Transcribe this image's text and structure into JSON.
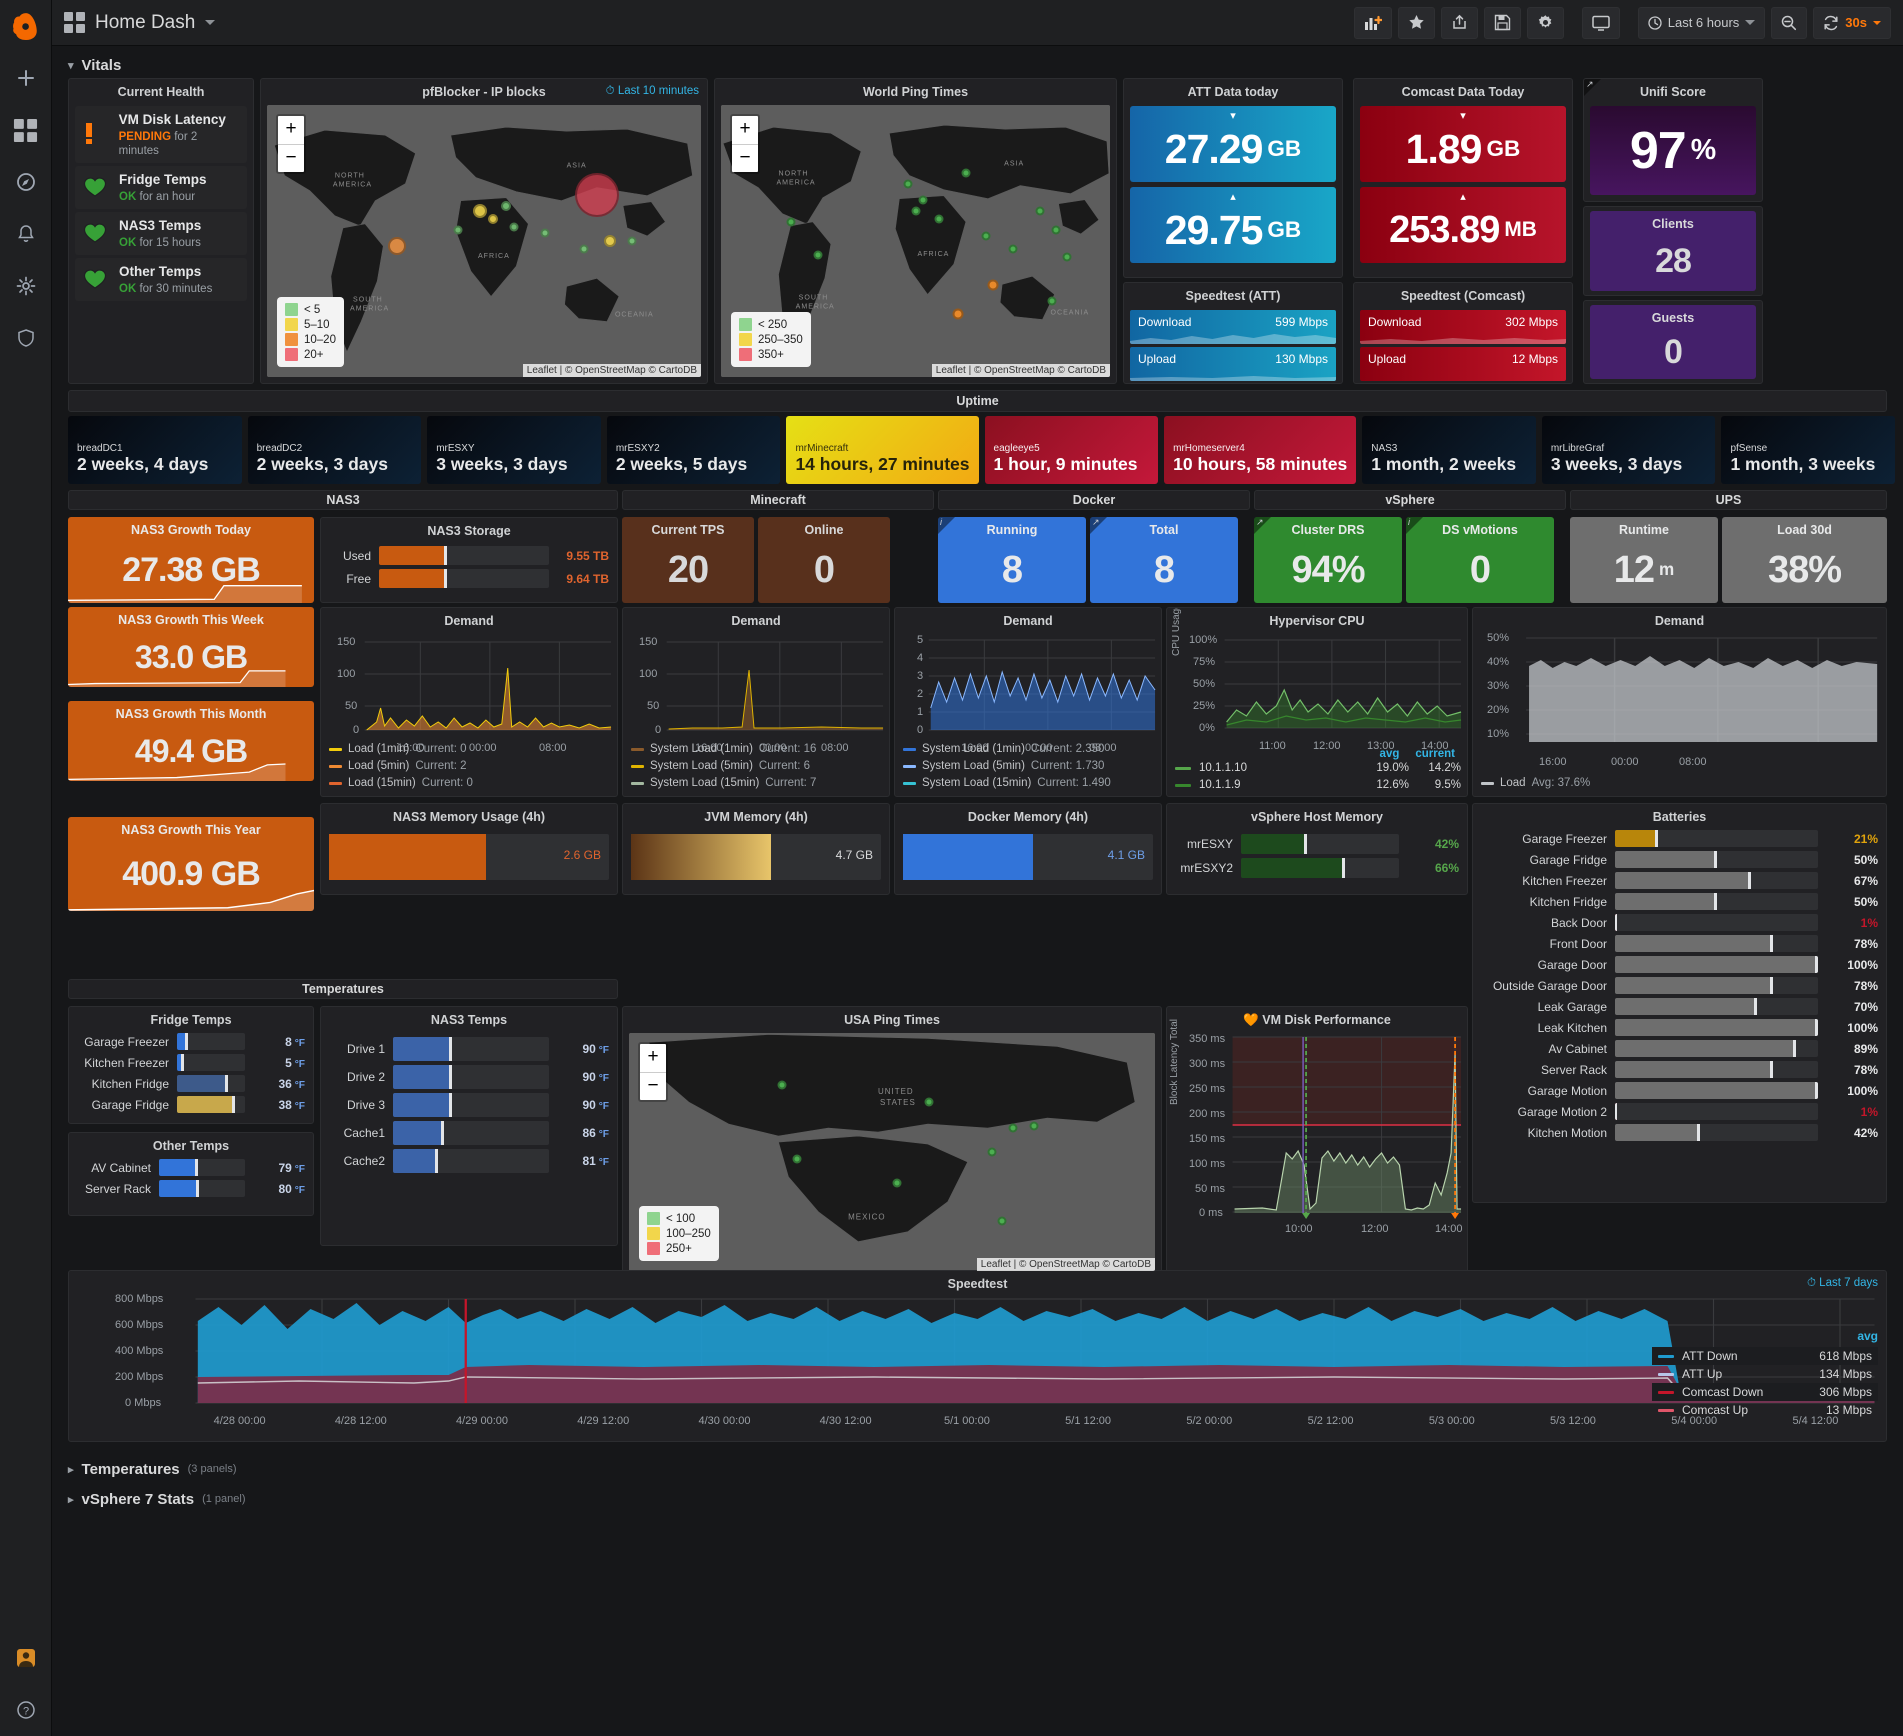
{
  "app": {
    "title": "Home Dash",
    "logo_icon": "grafana-logo"
  },
  "toolbar": {
    "add_panel_icon": "add-panel-icon",
    "star_icon": "star-icon",
    "share_icon": "share-icon",
    "save_icon": "save-icon",
    "settings_icon": "gear-icon",
    "tv_icon": "tv-mode-icon",
    "time_picker": "Last 6 hours",
    "zoom_out_icon": "zoom-out-icon",
    "refresh_icon": "refresh-icon",
    "refresh_interval": "30s"
  },
  "sidenav": [
    {
      "name": "create",
      "icon": "plus-icon"
    },
    {
      "name": "dashboards",
      "icon": "dashboards-icon"
    },
    {
      "name": "explore",
      "icon": "compass-icon"
    },
    {
      "name": "alerting",
      "icon": "bell-icon"
    },
    {
      "name": "configuration",
      "icon": "gear-icon"
    },
    {
      "name": "shield",
      "icon": "shield-icon"
    },
    {
      "name": "user",
      "icon": "avatar-icon"
    },
    {
      "name": "help",
      "icon": "question-icon"
    }
  ],
  "rows": {
    "vitals": "Vitals",
    "uptime": "Uptime",
    "temperatures": "Temperatures",
    "temperatures_count": "(3 panels)",
    "vsphere7": "vSphere 7 Stats",
    "vsphere7_count": "(1 panel)"
  },
  "current_health": {
    "title": "Current Health",
    "items": [
      {
        "name": "VM Disk Latency",
        "state": "PENDING",
        "detail": "for 2 minutes",
        "icon": "exclamation-icon",
        "color": "#ff780a"
      },
      {
        "name": "Fridge Temps",
        "state": "OK",
        "detail": "for an hour",
        "icon": "heart-icon",
        "color": "#37a137"
      },
      {
        "name": "NAS3 Temps",
        "state": "OK",
        "detail": "for 15 hours",
        "icon": "heart-icon",
        "color": "#37a137"
      },
      {
        "name": "Other Temps",
        "state": "OK",
        "detail": "for 30 minutes",
        "icon": "heart-icon",
        "color": "#37a137"
      }
    ]
  },
  "pfblocker": {
    "title": "pfBlocker - IP blocks",
    "time_range": "Last 10 minutes",
    "zoom_in": "+",
    "zoom_out": "−",
    "legend": [
      {
        "label": "< 5",
        "color": "#8fd48f"
      },
      {
        "label": "5–10",
        "color": "#f2d64b"
      },
      {
        "label": "10–20",
        "color": "#f0913e"
      },
      {
        "label": "20+",
        "color": "#ef6e78"
      }
    ],
    "attribution": "Leaflet | © OpenStreetMap © CartoDB"
  },
  "world_ping": {
    "title": "World Ping Times",
    "legend": [
      {
        "label": "< 250",
        "color": "#8fd48f"
      },
      {
        "label": "250–350",
        "color": "#f2d64b"
      },
      {
        "label": "350+",
        "color": "#ef6e78"
      }
    ],
    "attribution": "Leaflet | © OpenStreetMap © CartoDB"
  },
  "usa_ping": {
    "title": "USA Ping Times",
    "legend": [
      {
        "label": "< 100",
        "color": "#8fd48f"
      },
      {
        "label": "100–250",
        "color": "#f2d64b"
      },
      {
        "label": "250+",
        "color": "#ef6e78"
      }
    ],
    "attribution": "Leaflet | © OpenStreetMap © CartoDB"
  },
  "att": {
    "title": "ATT Data today",
    "down": {
      "value": "27.29",
      "unit": "GB",
      "arrow": "down"
    },
    "up": {
      "value": "29.75",
      "unit": "GB",
      "arrow": "up"
    },
    "speedtest_title": "Speedtest (ATT)",
    "download_label": "Download",
    "download_value": "599 Mbps",
    "upload_label": "Upload",
    "upload_value": "130 Mbps",
    "color": "#1a8cbe"
  },
  "comcast": {
    "title": "Comcast Data Today",
    "down": {
      "value": "1.89",
      "unit": "GB",
      "arrow": "down"
    },
    "up": {
      "value": "253.89",
      "unit": "MB",
      "arrow": "up"
    },
    "speedtest_title": "Speedtest (Comcast)",
    "download_label": "Download",
    "download_value": "302 Mbps",
    "upload_label": "Upload",
    "upload_value": "12 Mbps",
    "color": "#a00a1e"
  },
  "unifi": {
    "title": "Unifi Score",
    "score": "97",
    "score_unit": "%",
    "clients_title": "Clients",
    "clients": "28",
    "guests_title": "Guests",
    "guests": "0",
    "color": "#4a1d6e"
  },
  "uptime_tiles": [
    {
      "name": "breadDC1",
      "value": "2 weeks, 4 days",
      "color": "dark"
    },
    {
      "name": "breadDC2",
      "value": "2 weeks, 3 days",
      "color": "dark"
    },
    {
      "name": "mrESXY",
      "value": "3 weeks, 3 days",
      "color": "dark"
    },
    {
      "name": "mrESXY2",
      "value": "2 weeks, 5 days",
      "color": "dark"
    },
    {
      "name": "mrMinecraft",
      "value": "14 hours, 27 minutes",
      "color": "yellow"
    },
    {
      "name": "eagleeye5",
      "value": "1 hour, 9 minutes",
      "color": "red"
    },
    {
      "name": "mrHomeserver4",
      "value": "10 hours, 58 minutes",
      "color": "red"
    },
    {
      "name": "NAS3",
      "value": "1 month, 2 weeks",
      "color": "dark"
    },
    {
      "name": "mrLibreGraf",
      "value": "3 weeks, 3 days",
      "color": "dark"
    },
    {
      "name": "pfSense",
      "value": "1 month, 3 weeks",
      "color": "dark"
    }
  ],
  "sections": {
    "nas3": "NAS3",
    "minecraft": "Minecraft",
    "docker": "Docker",
    "vsphere": "vSphere",
    "ups": "UPS"
  },
  "nas3": {
    "growth_today": {
      "title": "NAS3 Growth Today",
      "value": "27.38 GB"
    },
    "growth_week": {
      "title": "NAS3 Growth This Week",
      "value": "33.0 GB"
    },
    "growth_month": {
      "title": "NAS3 Growth This Month",
      "value": "49.4 GB"
    },
    "growth_year": {
      "title": "NAS3 Growth This Year",
      "value": "400.9 GB"
    },
    "storage": {
      "title": "NAS3 Storage",
      "rows": [
        {
          "label": "Used",
          "value": "9.55 TB",
          "pct": 40
        },
        {
          "label": "Free",
          "value": "9.64 TB",
          "pct": 40
        }
      ]
    },
    "demand": {
      "title": "Demand",
      "yticks": [
        "150",
        "100",
        "50",
        "0"
      ],
      "xticks": [
        "16:00",
        "00:00",
        "08:00"
      ],
      "legend": [
        {
          "name": "Load (1min)",
          "value": "Current: 0",
          "color": "#f2cc0c"
        },
        {
          "name": "Load (5min)",
          "value": "Current: 2",
          "color": "#ef8a33"
        },
        {
          "name": "Load (15min)",
          "value": "Current: 0",
          "color": "#e0642e"
        }
      ]
    },
    "memory": {
      "title": "NAS3 Memory Usage (4h)",
      "value": "2.6 GB",
      "pct": 56
    },
    "temps": {
      "title": "NAS3 Temps",
      "rows": [
        {
          "label": "Drive 1",
          "value": "90",
          "unit": "°F",
          "pct": 38
        },
        {
          "label": "Drive 2",
          "value": "90",
          "unit": "°F",
          "pct": 38
        },
        {
          "label": "Drive 3",
          "value": "90",
          "unit": "°F",
          "pct": 38
        },
        {
          "label": "Cache1",
          "value": "86",
          "unit": "°F",
          "pct": 33
        },
        {
          "label": "Cache2",
          "value": "81",
          "unit": "°F",
          "pct": 29
        }
      ]
    }
  },
  "minecraft": {
    "tps": {
      "title": "Current TPS",
      "value": "20"
    },
    "online": {
      "title": "Online",
      "value": "0"
    },
    "demand": {
      "title": "Demand",
      "yticks": [
        "150",
        "100",
        "50",
        "0"
      ],
      "xticks": [
        "16:00",
        "00:00",
        "08:00"
      ],
      "legend": [
        {
          "name": "System Load (1min)",
          "value": "Current: 16",
          "color": "#8a5a2b"
        },
        {
          "name": "System Load (5min)",
          "value": "Current: 6",
          "color": "#e0b400"
        },
        {
          "name": "System Load (15min)",
          "value": "Current: 7",
          "color": "#a3b8a0"
        }
      ]
    },
    "jvm": {
      "title": "JVM Memory (4h)",
      "value": "4.7 GB",
      "pct": 56
    }
  },
  "docker": {
    "running": {
      "title": "Running",
      "value": "8"
    },
    "total": {
      "title": "Total",
      "value": "8"
    },
    "demand": {
      "title": "Demand",
      "yticks": [
        "5",
        "4",
        "3",
        "2",
        "1",
        "0"
      ],
      "xticks": [
        "16:00",
        "00:00",
        "08:00"
      ],
      "legend": [
        {
          "name": "System Load (1min)",
          "value": "Current: 2.350",
          "color": "#3274d9"
        },
        {
          "name": "System Load (5min)",
          "value": "Current: 1.730",
          "color": "#8ab8ff"
        },
        {
          "name": "System Load (15min)",
          "value": "Current: 1.490",
          "color": "#36c2d4"
        }
      ]
    },
    "memory": {
      "title": "Docker Memory (4h)",
      "value": "4.1 GB",
      "pct": 52
    }
  },
  "vsphere": {
    "cluster_drs": {
      "title": "Cluster DRS",
      "value": "94%"
    },
    "ds_vmotions": {
      "title": "DS vMotions",
      "value": "0"
    },
    "hypervisor_cpu": {
      "title": "Hypervisor CPU",
      "ylabel": "CPU Usage Avg. %",
      "yticks": [
        "100%",
        "75%",
        "50%",
        "25%",
        "0%"
      ],
      "xticks": [
        "11:00",
        "12:00",
        "13:00",
        "14:00"
      ],
      "legend_hdr": [
        "avg",
        "current"
      ],
      "legend": [
        {
          "name": "10.1.1.10",
          "avg": "19.0%",
          "current": "14.2%",
          "color": "#56a64b"
        },
        {
          "name": "10.1.1.9",
          "avg": "12.6%",
          "current": "9.5%",
          "color": "#37872d"
        }
      ]
    },
    "host_memory": {
      "title": "vSphere Host Memory",
      "rows": [
        {
          "label": "mrESXY",
          "value": "42%",
          "pct": 42
        },
        {
          "label": "mrESXY2",
          "value": "66%",
          "pct": 66
        }
      ]
    },
    "vm_disk": {
      "title": "VM Disk Performance",
      "icon": "heart-icon",
      "ylabel": "Block Latency Total",
      "yticks": [
        "350 ms",
        "300 ms",
        "250 ms",
        "200 ms",
        "150 ms",
        "100 ms",
        "50 ms",
        "0 ms"
      ],
      "xticks": [
        "10:00",
        "12:00",
        "14:00"
      ],
      "threshold": "150 ms"
    }
  },
  "ups": {
    "runtime": {
      "title": "Runtime",
      "value": "12",
      "unit": "m"
    },
    "load30d": {
      "title": "Load 30d",
      "value": "38%"
    },
    "demand": {
      "title": "Demand",
      "yticks": [
        "50%",
        "40%",
        "30%",
        "20%",
        "10%"
      ],
      "xticks": [
        "16:00",
        "00:00",
        "08:00"
      ],
      "legend": [
        {
          "name": "Load",
          "value": "Avg: 37.6%",
          "color": "#c0c4c8"
        }
      ]
    },
    "batteries": {
      "title": "Batteries",
      "rows": [
        {
          "label": "Garage Freezer",
          "value": "21%",
          "pct": 21,
          "color": "#b8860b"
        },
        {
          "label": "Garage Fridge",
          "value": "50%",
          "pct": 50,
          "color": "#6e6e6e"
        },
        {
          "label": "Kitchen Freezer",
          "value": "67%",
          "pct": 67,
          "color": "#6e6e6e"
        },
        {
          "label": "Kitchen Fridge",
          "value": "50%",
          "pct": 50,
          "color": "#6e6e6e"
        },
        {
          "label": "Back Door",
          "value": "1%",
          "pct": 1,
          "color": "#c4162a"
        },
        {
          "label": "Front Door",
          "value": "78%",
          "pct": 78,
          "color": "#6e6e6e"
        },
        {
          "label": "Garage Door",
          "value": "100%",
          "pct": 100,
          "color": "#6e6e6e"
        },
        {
          "label": "Outside Garage Door",
          "value": "78%",
          "pct": 78,
          "color": "#6e6e6e"
        },
        {
          "label": "Leak Garage",
          "value": "70%",
          "pct": 70,
          "color": "#6e6e6e"
        },
        {
          "label": "Leak Kitchen",
          "value": "100%",
          "pct": 100,
          "color": "#6e6e6e"
        },
        {
          "label": "Av Cabinet",
          "value": "89%",
          "pct": 89,
          "color": "#6e6e6e"
        },
        {
          "label": "Server Rack",
          "value": "78%",
          "pct": 78,
          "color": "#6e6e6e"
        },
        {
          "label": "Garage Motion",
          "value": "100%",
          "pct": 100,
          "color": "#6e6e6e"
        },
        {
          "label": "Garage Motion 2",
          "value": "1%",
          "pct": 1,
          "color": "#c4162a"
        },
        {
          "label": "Kitchen Motion",
          "value": "42%",
          "pct": 42,
          "color": "#6e6e6e"
        }
      ]
    }
  },
  "temperatures": {
    "section_title": "Temperatures",
    "fridge": {
      "title": "Fridge Temps",
      "rows": [
        {
          "label": "Garage Freezer",
          "value": "8",
          "unit": "°F",
          "pct": 16,
          "color": "#3274d9"
        },
        {
          "label": "Kitchen Freezer",
          "value": "5",
          "unit": "°F",
          "pct": 10,
          "color": "#3274d9"
        },
        {
          "label": "Kitchen Fridge",
          "value": "36",
          "unit": "°F",
          "pct": 75,
          "color": "#3d5a8a"
        },
        {
          "label": "Garage Fridge",
          "value": "38",
          "unit": "°F",
          "pct": 85,
          "color": "#c8a84b"
        }
      ]
    },
    "other": {
      "title": "Other Temps",
      "rows": [
        {
          "label": "AV Cabinet",
          "value": "79",
          "unit": "°F",
          "pct": 45,
          "color": "#3274d9"
        },
        {
          "label": "Server Rack",
          "value": "80",
          "unit": "°F",
          "pct": 47,
          "color": "#3274d9"
        }
      ]
    }
  },
  "speedtest": {
    "title": "Speedtest",
    "time_range": "Last 7 days",
    "yticks": [
      "800 Mbps",
      "600 Mbps",
      "400 Mbps",
      "200 Mbps",
      "0 Mbps"
    ],
    "xticks": [
      "4/28 00:00",
      "4/28 12:00",
      "4/29 00:00",
      "4/29 12:00",
      "4/30 00:00",
      "4/30 12:00",
      "5/1 00:00",
      "5/1 12:00",
      "5/2 00:00",
      "5/2 12:00",
      "5/3 00:00",
      "5/3 12:00",
      "5/4 00:00",
      "5/4 12:00"
    ],
    "legend_hdr": "avg",
    "legend": [
      {
        "name": "ATT Down",
        "value": "618 Mbps",
        "color": "#1f9bcf"
      },
      {
        "name": "ATT Up",
        "value": "134 Mbps",
        "color": "#b8c6e8"
      },
      {
        "name": "Comcast Down",
        "value": "306 Mbps",
        "color": "#c4162a"
      },
      {
        "name": "Comcast Up",
        "value": "13 Mbps",
        "color": "#e0566a"
      }
    ]
  },
  "chart_data": [
    {
      "type": "line",
      "title": "NAS3 Demand",
      "ylabel": "",
      "ylim": [
        0,
        150
      ],
      "xlabel": "",
      "xticks": [
        "16:00",
        "00:00",
        "08:00"
      ],
      "series": [
        {
          "name": "Load (1min)",
          "current": 0,
          "color": "#f2cc0c"
        },
        {
          "name": "Load (5min)",
          "current": 2,
          "color": "#ef8a33"
        },
        {
          "name": "Load (15min)",
          "current": 0,
          "color": "#e0642e"
        }
      ]
    },
    {
      "type": "line",
      "title": "Minecraft Demand",
      "ylim": [
        0,
        150
      ],
      "xticks": [
        "16:00",
        "00:00",
        "08:00"
      ],
      "series": [
        {
          "name": "System Load (1min)",
          "current": 16,
          "color": "#8a5a2b"
        },
        {
          "name": "System Load (5min)",
          "current": 6,
          "color": "#e0b400"
        },
        {
          "name": "System Load (15min)",
          "current": 7,
          "color": "#a3b8a0"
        }
      ]
    },
    {
      "type": "line",
      "title": "Docker Demand",
      "ylim": [
        0,
        5
      ],
      "xticks": [
        "16:00",
        "00:00",
        "08:00"
      ],
      "series": [
        {
          "name": "System Load (1min)",
          "current": 2.35,
          "color": "#3274d9"
        },
        {
          "name": "System Load (5min)",
          "current": 1.73,
          "color": "#8ab8ff"
        },
        {
          "name": "System Load (15min)",
          "current": 1.49,
          "color": "#36c2d4"
        }
      ]
    },
    {
      "type": "line",
      "title": "Hypervisor CPU",
      "ylabel": "CPU Usage Avg. %",
      "ylim": [
        0,
        100
      ],
      "xticks": [
        "11:00",
        "12:00",
        "13:00",
        "14:00"
      ],
      "series": [
        {
          "name": "10.1.1.10",
          "avg": 19.0,
          "current": 14.2,
          "color": "#56a64b"
        },
        {
          "name": "10.1.1.9",
          "avg": 12.6,
          "current": 9.5,
          "color": "#37872d"
        }
      ]
    },
    {
      "type": "line",
      "title": "UPS Demand",
      "ylim": [
        10,
        50
      ],
      "xticks": [
        "16:00",
        "00:00",
        "08:00"
      ],
      "series": [
        {
          "name": "Load",
          "avg": 37.6,
          "color": "#c0c4c8"
        }
      ]
    },
    {
      "type": "line",
      "title": "VM Disk Performance",
      "ylabel": "Block Latency Total",
      "ylim": [
        0,
        350
      ],
      "xticks": [
        "10:00",
        "12:00",
        "14:00"
      ],
      "threshold": 150,
      "series": [
        {
          "name": "latency",
          "color": "#b3d4a8"
        }
      ]
    },
    {
      "type": "area",
      "title": "Speedtest",
      "ylabel": "",
      "ylim": [
        0,
        800
      ],
      "xticks": [
        "4/28 00:00",
        "4/28 12:00",
        "4/29 00:00",
        "4/29 12:00",
        "4/30 00:00",
        "4/30 12:00",
        "5/1 00:00",
        "5/1 12:00",
        "5/2 00:00",
        "5/2 12:00",
        "5/3 00:00",
        "5/3 12:00",
        "5/4 00:00",
        "5/4 12:00"
      ],
      "series": [
        {
          "name": "ATT Down",
          "avg": 618,
          "color": "#1f9bcf"
        },
        {
          "name": "ATT Up",
          "avg": 134,
          "color": "#b8c6e8"
        },
        {
          "name": "Comcast Down",
          "avg": 306,
          "color": "#c4162a"
        },
        {
          "name": "Comcast Up",
          "avg": 13,
          "color": "#e0566a"
        }
      ]
    }
  ]
}
